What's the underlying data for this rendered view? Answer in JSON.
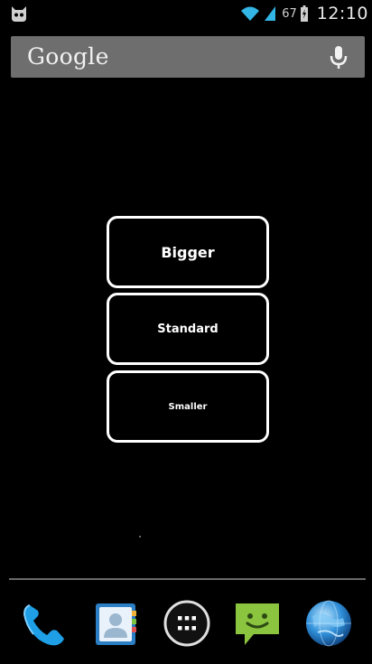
{
  "status_bar": {
    "notification_icon": "cyanogenmod-icon",
    "wifi_icon": "wifi-icon",
    "signal_icon": "cell-signal-icon",
    "battery_percent": "67",
    "battery_icon": "battery-charging-icon",
    "time": "12:10"
  },
  "search_bar": {
    "logo_text": "Google",
    "mic_icon": "microphone-icon"
  },
  "widget": {
    "bigger_label": "Bigger",
    "standard_label": "Standard",
    "smaller_label": "Smaller"
  },
  "dock": {
    "items": [
      {
        "icon": "phone-icon",
        "color": "#1e9fe6"
      },
      {
        "icon": "contacts-icon",
        "color": "#2c7fc4"
      },
      {
        "icon": "apps-icon",
        "color": "#ffffff"
      },
      {
        "icon": "messaging-icon",
        "color": "#8bc43f"
      },
      {
        "icon": "browser-globe-icon",
        "color": "#2f8fd8"
      }
    ]
  }
}
